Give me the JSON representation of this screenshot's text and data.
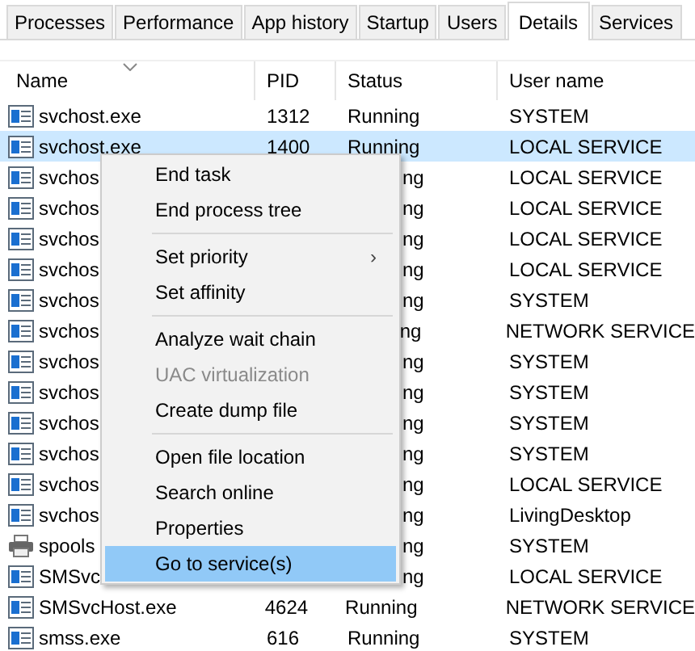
{
  "tabs": [
    {
      "label": "Processes",
      "selected": false
    },
    {
      "label": "Performance",
      "selected": false
    },
    {
      "label": "App history",
      "selected": false
    },
    {
      "label": "Startup",
      "selected": false
    },
    {
      "label": "Users",
      "selected": false
    },
    {
      "label": "Details",
      "selected": true
    },
    {
      "label": "Services",
      "selected": false
    }
  ],
  "table": {
    "columns": [
      "Name",
      "PID",
      "Status",
      "User name"
    ],
    "rows": [
      {
        "kind": "app",
        "name": "svchost.exe",
        "pid": "1312",
        "status": "Running",
        "user": "SYSTEM",
        "selected": false
      },
      {
        "kind": "app",
        "name": "svchost.exe",
        "pid": "1400",
        "status": "Running",
        "user": "LOCAL SERVICE",
        "selected": true
      },
      {
        "kind": "app",
        "name": "svchos",
        "status": "ng",
        "user": "LOCAL SERVICE",
        "selected": false
      },
      {
        "kind": "app",
        "name": "svchos",
        "status": "ng",
        "user": "LOCAL SERVICE",
        "selected": false
      },
      {
        "kind": "app",
        "name": "svchos",
        "status": "ng",
        "user": "LOCAL SERVICE",
        "selected": false
      },
      {
        "kind": "app",
        "name": "svchos",
        "status": "ng",
        "user": "LOCAL SERVICE",
        "selected": false
      },
      {
        "kind": "app",
        "name": "svchos",
        "status": "ng",
        "user": "SYSTEM",
        "selected": false
      },
      {
        "kind": "app",
        "name": "svchos",
        "status": "ng",
        "user": "NETWORK SERVICE",
        "selected": false
      },
      {
        "kind": "app",
        "name": "svchos",
        "status": "ng",
        "user": "SYSTEM",
        "selected": false
      },
      {
        "kind": "app",
        "name": "svchos",
        "status": "ng",
        "user": "SYSTEM",
        "selected": false
      },
      {
        "kind": "app",
        "name": "svchos",
        "status": "ng",
        "user": "SYSTEM",
        "selected": false
      },
      {
        "kind": "app",
        "name": "svchos",
        "status": "ng",
        "user": "SYSTEM",
        "selected": false
      },
      {
        "kind": "app",
        "name": "svchos",
        "status": "ng",
        "user": "LOCAL SERVICE",
        "selected": false
      },
      {
        "kind": "app",
        "name": "svchos",
        "status": "ng",
        "user": "LivingDesktop",
        "selected": false
      },
      {
        "kind": "printer",
        "name": "spools",
        "status": "ng",
        "user": "SYSTEM",
        "selected": false
      },
      {
        "kind": "app",
        "name": "SMSvc",
        "status": "ng",
        "user": "LOCAL SERVICE",
        "selected": false
      },
      {
        "kind": "app",
        "name": "SMSvcHost.exe",
        "pid": "4624",
        "status": "Running",
        "user": "NETWORK SERVICE",
        "selected": false
      },
      {
        "kind": "app",
        "name": "smss.exe",
        "pid": "616",
        "status": "Running",
        "user": "SYSTEM",
        "selected": false
      }
    ]
  },
  "context_menu": [
    {
      "kind": "item",
      "label": "End task",
      "disabled": false,
      "selected": false
    },
    {
      "kind": "item",
      "label": "End process tree",
      "disabled": false,
      "selected": false
    },
    {
      "kind": "separator"
    },
    {
      "kind": "submenu",
      "label": "Set priority",
      "arrow": "›",
      "disabled": false,
      "selected": false
    },
    {
      "kind": "item",
      "label": "Set affinity",
      "disabled": false,
      "selected": false
    },
    {
      "kind": "separator"
    },
    {
      "kind": "item",
      "label": "Analyze wait chain",
      "disabled": false,
      "selected": false
    },
    {
      "kind": "item",
      "label": "UAC virtualization",
      "disabled": true,
      "selected": false
    },
    {
      "kind": "item",
      "label": "Create dump file",
      "disabled": false,
      "selected": false
    },
    {
      "kind": "separator"
    },
    {
      "kind": "item",
      "label": "Open file location",
      "disabled": false,
      "selected": false
    },
    {
      "kind": "item",
      "label": "Search online",
      "disabled": false,
      "selected": false
    },
    {
      "kind": "item",
      "label": "Properties",
      "disabled": false,
      "selected": false
    },
    {
      "kind": "item",
      "label": "Go to service(s)",
      "disabled": false,
      "selected": true
    }
  ]
}
